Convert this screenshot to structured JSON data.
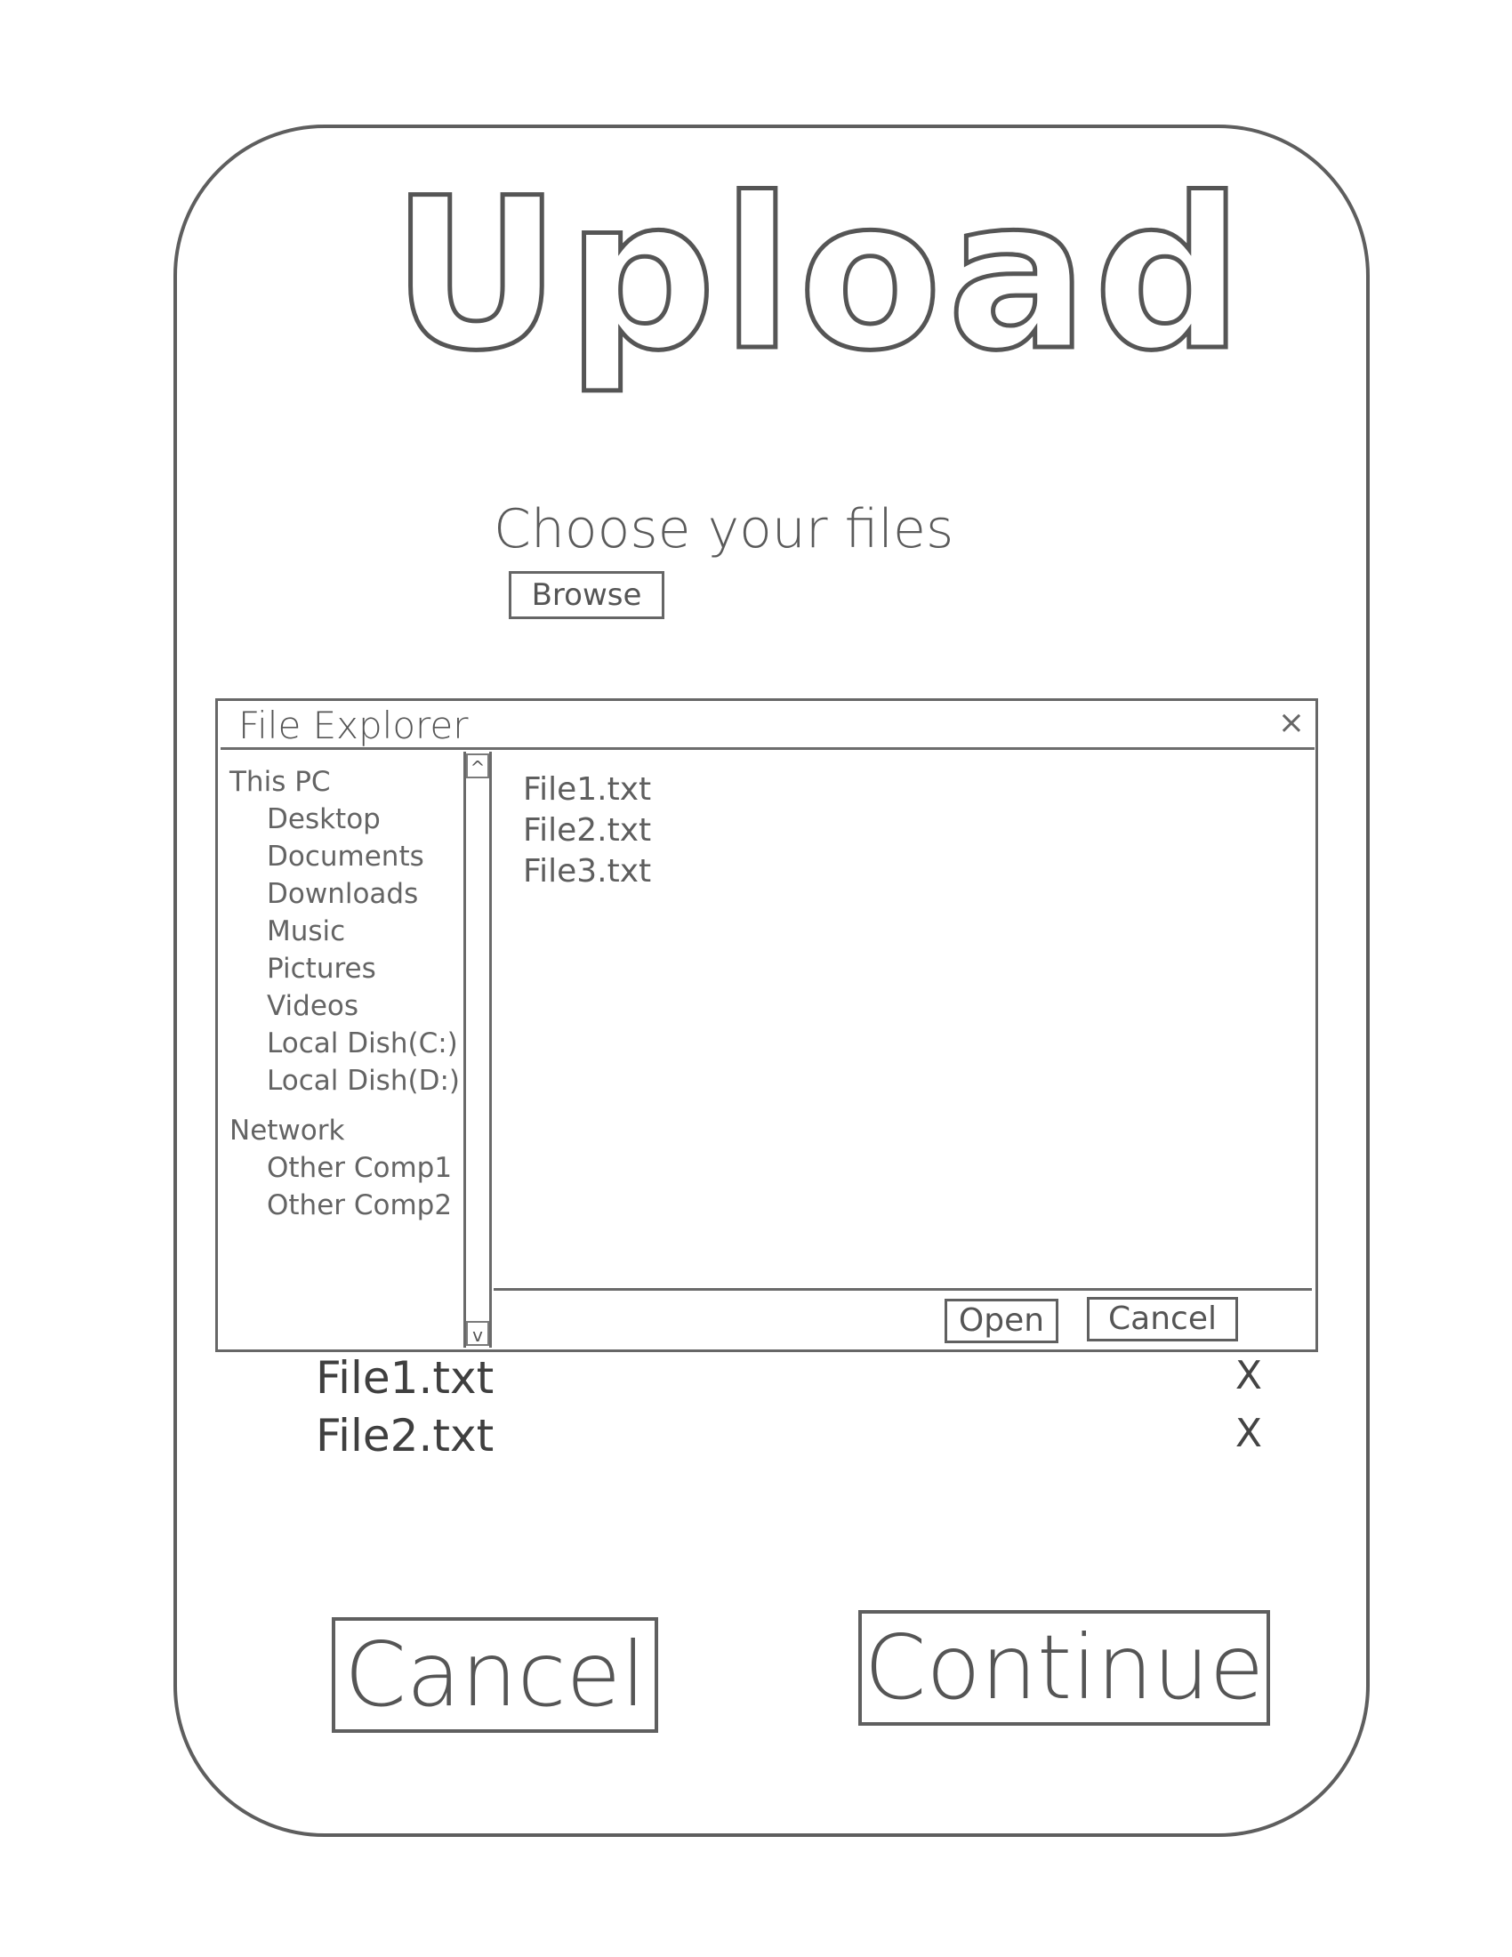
{
  "page": {
    "title": "Upload",
    "instruction": "Choose your files",
    "browse_label": "Browse"
  },
  "explorer": {
    "title": "File Explorer",
    "close_icon": "close-icon",
    "close_glyph": "×",
    "tree": {
      "this_pc": "This PC",
      "this_pc_items": [
        "Desktop",
        "Documents",
        "Downloads",
        "Music",
        "Pictures",
        "Videos",
        "Local Dish(C:)",
        "Local Dish(D:)"
      ],
      "network": "Network",
      "network_items": [
        "Other Comp1",
        "Other Comp2"
      ]
    },
    "scroll_up_glyph": "^",
    "scroll_down_glyph": "v",
    "files": [
      "File1.txt",
      "File2.txt",
      "File3.txt"
    ],
    "open_label": "Open",
    "cancel_label": "Cancel"
  },
  "selected_files": [
    {
      "name": "File1.txt",
      "remove_glyph": "X"
    },
    {
      "name": "File2.txt",
      "remove_glyph": "X"
    }
  ],
  "actions": {
    "cancel_label": "Cancel",
    "continue_label": "Continue"
  },
  "colors": {
    "ink": "#555555",
    "paper": "#ffffff"
  }
}
